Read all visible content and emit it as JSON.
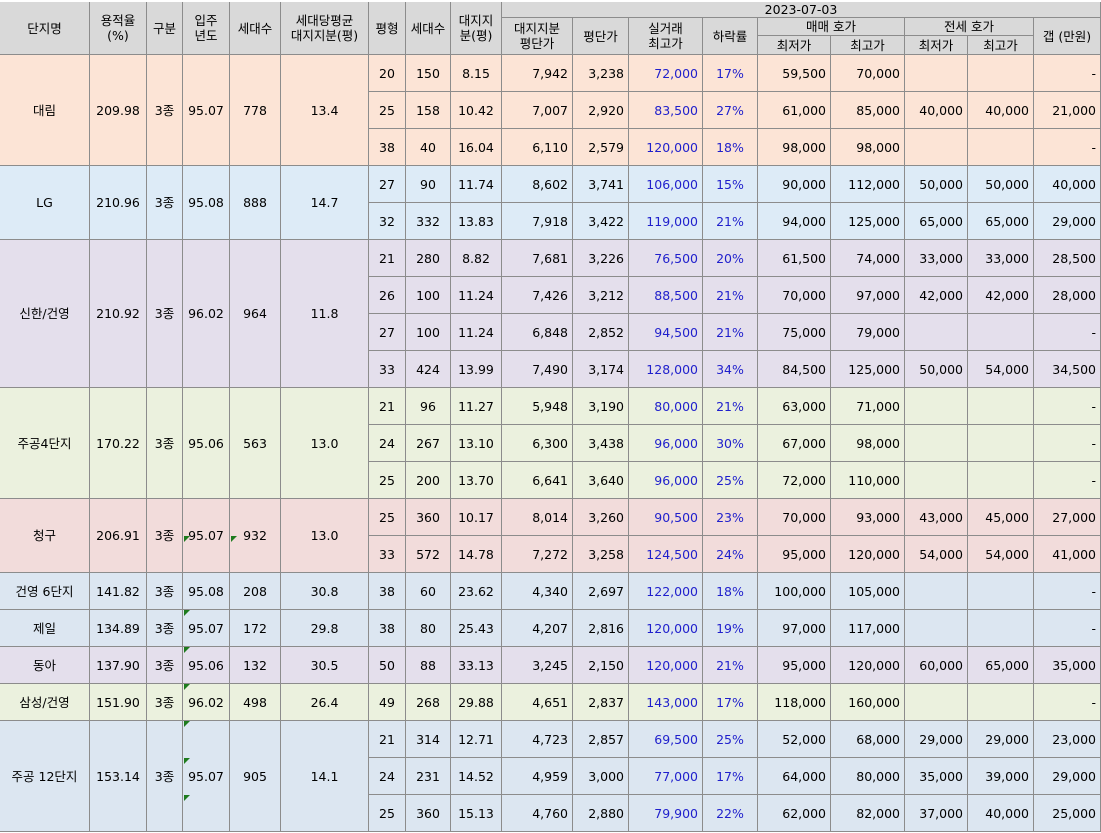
{
  "colors": {
    "header_bg": "#d9d9d9",
    "grid": "#8c8c8c",
    "price_text": "#1f1fcc",
    "complex_bg": [
      "#fce4d6",
      "#ddebf7",
      "#e4dfec",
      "#ebf1de",
      "#f2dcdb",
      "#dce6f1",
      "#dce6f1",
      "#e4dfec",
      "#ebf1de",
      "#dce6f1"
    ]
  },
  "header": {
    "date": "2023-07-03",
    "name": "단지명",
    "far": "용적율\n(%)",
    "zone": "구분",
    "year": "입주\n년도",
    "households": "세대수",
    "avg_land": "세대당평균\n대지지분(평)",
    "pyeong": "평형",
    "unit_households": "세대수",
    "land_share": "대지지\n분(평)",
    "land_unit_price": "대지지분\n평단가",
    "unit_price": "평단가",
    "max_trade": "실거래\n최고가",
    "drop_rate": "하락률",
    "sale_group": "매매 호가",
    "sale_min": "최저가",
    "sale_max": "최고가",
    "jeonse_group": "전세 호가",
    "jeonse_min": "최저가",
    "jeonse_max": "최고가",
    "gap": "갭 (만원)"
  },
  "complexes": [
    {
      "name": "대림",
      "far": "209.98",
      "zone": "3종",
      "year": "95.07",
      "households": "778",
      "avg_land": "13.4",
      "rows": [
        [
          "20",
          "150",
          "8.15",
          "7,942",
          "3,238",
          "72,000",
          "17%",
          "59,500",
          "70,000",
          "",
          "",
          "-"
        ],
        [
          "25",
          "158",
          "10.42",
          "7,007",
          "2,920",
          "83,500",
          "27%",
          "61,000",
          "85,000",
          "40,000",
          "40,000",
          "21,000"
        ],
        [
          "38",
          "40",
          "16.04",
          "6,110",
          "2,579",
          "120,000",
          "18%",
          "98,000",
          "98,000",
          "",
          "",
          "-"
        ]
      ]
    },
    {
      "name": "LG",
      "far": "210.96",
      "zone": "3종",
      "year": "95.08",
      "households": "888",
      "avg_land": "14.7",
      "rows": [
        [
          "27",
          "90",
          "11.74",
          "8,602",
          "3,741",
          "106,000",
          "15%",
          "90,000",
          "112,000",
          "50,000",
          "50,000",
          "40,000"
        ],
        [
          "32",
          "332",
          "13.83",
          "7,918",
          "3,422",
          "119,000",
          "21%",
          "94,000",
          "125,000",
          "65,000",
          "65,000",
          "29,000"
        ]
      ]
    },
    {
      "name": "신한/건영",
      "far": "210.92",
      "zone": "3종",
      "year": "96.02",
      "households": "964",
      "avg_land": "11.8",
      "rows": [
        [
          "21",
          "280",
          "8.82",
          "7,681",
          "3,226",
          "76,500",
          "20%",
          "61,500",
          "74,000",
          "33,000",
          "33,000",
          "28,500"
        ],
        [
          "26",
          "100",
          "11.24",
          "7,426",
          "3,212",
          "88,500",
          "21%",
          "70,000",
          "97,000",
          "42,000",
          "42,000",
          "28,000"
        ],
        [
          "27",
          "100",
          "11.24",
          "6,848",
          "2,852",
          "94,500",
          "21%",
          "75,000",
          "79,000",
          "",
          "",
          "-"
        ],
        [
          "33",
          "424",
          "13.99",
          "7,490",
          "3,174",
          "128,000",
          "34%",
          "84,500",
          "125,000",
          "50,000",
          "54,000",
          "34,500"
        ]
      ]
    },
    {
      "name": "주공4단지",
      "far": "170.22",
      "zone": "3종",
      "year": "95.06",
      "households": "563",
      "avg_land": "13.0",
      "rows": [
        [
          "21",
          "96",
          "11.27",
          "5,948",
          "3,190",
          "80,000",
          "21%",
          "63,000",
          "71,000",
          "",
          "",
          "-"
        ],
        [
          "24",
          "267",
          "13.10",
          "6,300",
          "3,438",
          "96,000",
          "30%",
          "67,000",
          "98,000",
          "",
          "",
          "-"
        ],
        [
          "25",
          "200",
          "13.70",
          "6,641",
          "3,640",
          "96,000",
          "25%",
          "72,000",
          "110,000",
          "",
          "",
          "-"
        ]
      ]
    },
    {
      "name": "청구",
      "far": "206.91",
      "zone": "3종",
      "year": "95.07",
      "households": "932",
      "avg_land": "13.0",
      "rows": [
        [
          "25",
          "360",
          "10.17",
          "8,014",
          "3,260",
          "90,500",
          "23%",
          "70,000",
          "93,000",
          "43,000",
          "45,000",
          "27,000"
        ],
        [
          "33",
          "572",
          "14.78",
          "7,272",
          "3,258",
          "124,500",
          "24%",
          "95,000",
          "120,000",
          "54,000",
          "54,000",
          "41,000"
        ]
      ]
    },
    {
      "name": "건영 6단지",
      "far": "141.82",
      "zone": "3종",
      "year": "95.08",
      "households": "208",
      "avg_land": "30.8",
      "rows": [
        [
          "38",
          "60",
          "23.62",
          "4,340",
          "2,697",
          "122,000",
          "18%",
          "100,000",
          "105,000",
          "",
          "",
          "-"
        ]
      ]
    },
    {
      "name": "제일",
      "far": "134.89",
      "zone": "3종",
      "year": "95.07",
      "households": "172",
      "avg_land": "29.8",
      "rows": [
        [
          "38",
          "80",
          "25.43",
          "4,207",
          "2,816",
          "120,000",
          "19%",
          "97,000",
          "117,000",
          "",
          "",
          "-"
        ]
      ]
    },
    {
      "name": "동아",
      "far": "137.90",
      "zone": "3종",
      "year": "95.06",
      "households": "132",
      "avg_land": "30.5",
      "rows": [
        [
          "50",
          "88",
          "33.13",
          "3,245",
          "2,150",
          "120,000",
          "21%",
          "95,000",
          "120,000",
          "60,000",
          "65,000",
          "35,000"
        ]
      ]
    },
    {
      "name": "삼성/건영",
      "far": "151.90",
      "zone": "3종",
      "year": "96.02",
      "households": "498",
      "avg_land": "26.4",
      "rows": [
        [
          "49",
          "268",
          "29.88",
          "4,651",
          "2,837",
          "143,000",
          "17%",
          "118,000",
          "160,000",
          "",
          "",
          "-"
        ]
      ]
    },
    {
      "name": "주공 12단지",
      "far": "153.14",
      "zone": "3종",
      "year": "95.07",
      "households": "905",
      "avg_land": "14.1",
      "rows": [
        [
          "21",
          "314",
          "12.71",
          "4,723",
          "2,857",
          "69,500",
          "25%",
          "52,000",
          "68,000",
          "29,000",
          "29,000",
          "23,000"
        ],
        [
          "24",
          "231",
          "14.52",
          "4,959",
          "3,000",
          "77,000",
          "17%",
          "64,000",
          "80,000",
          "35,000",
          "39,000",
          "29,000"
        ],
        [
          "25",
          "360",
          "15.13",
          "4,760",
          "2,880",
          "79,900",
          "22%",
          "62,000",
          "82,000",
          "37,000",
          "40,000",
          "25,000"
        ]
      ]
    }
  ]
}
